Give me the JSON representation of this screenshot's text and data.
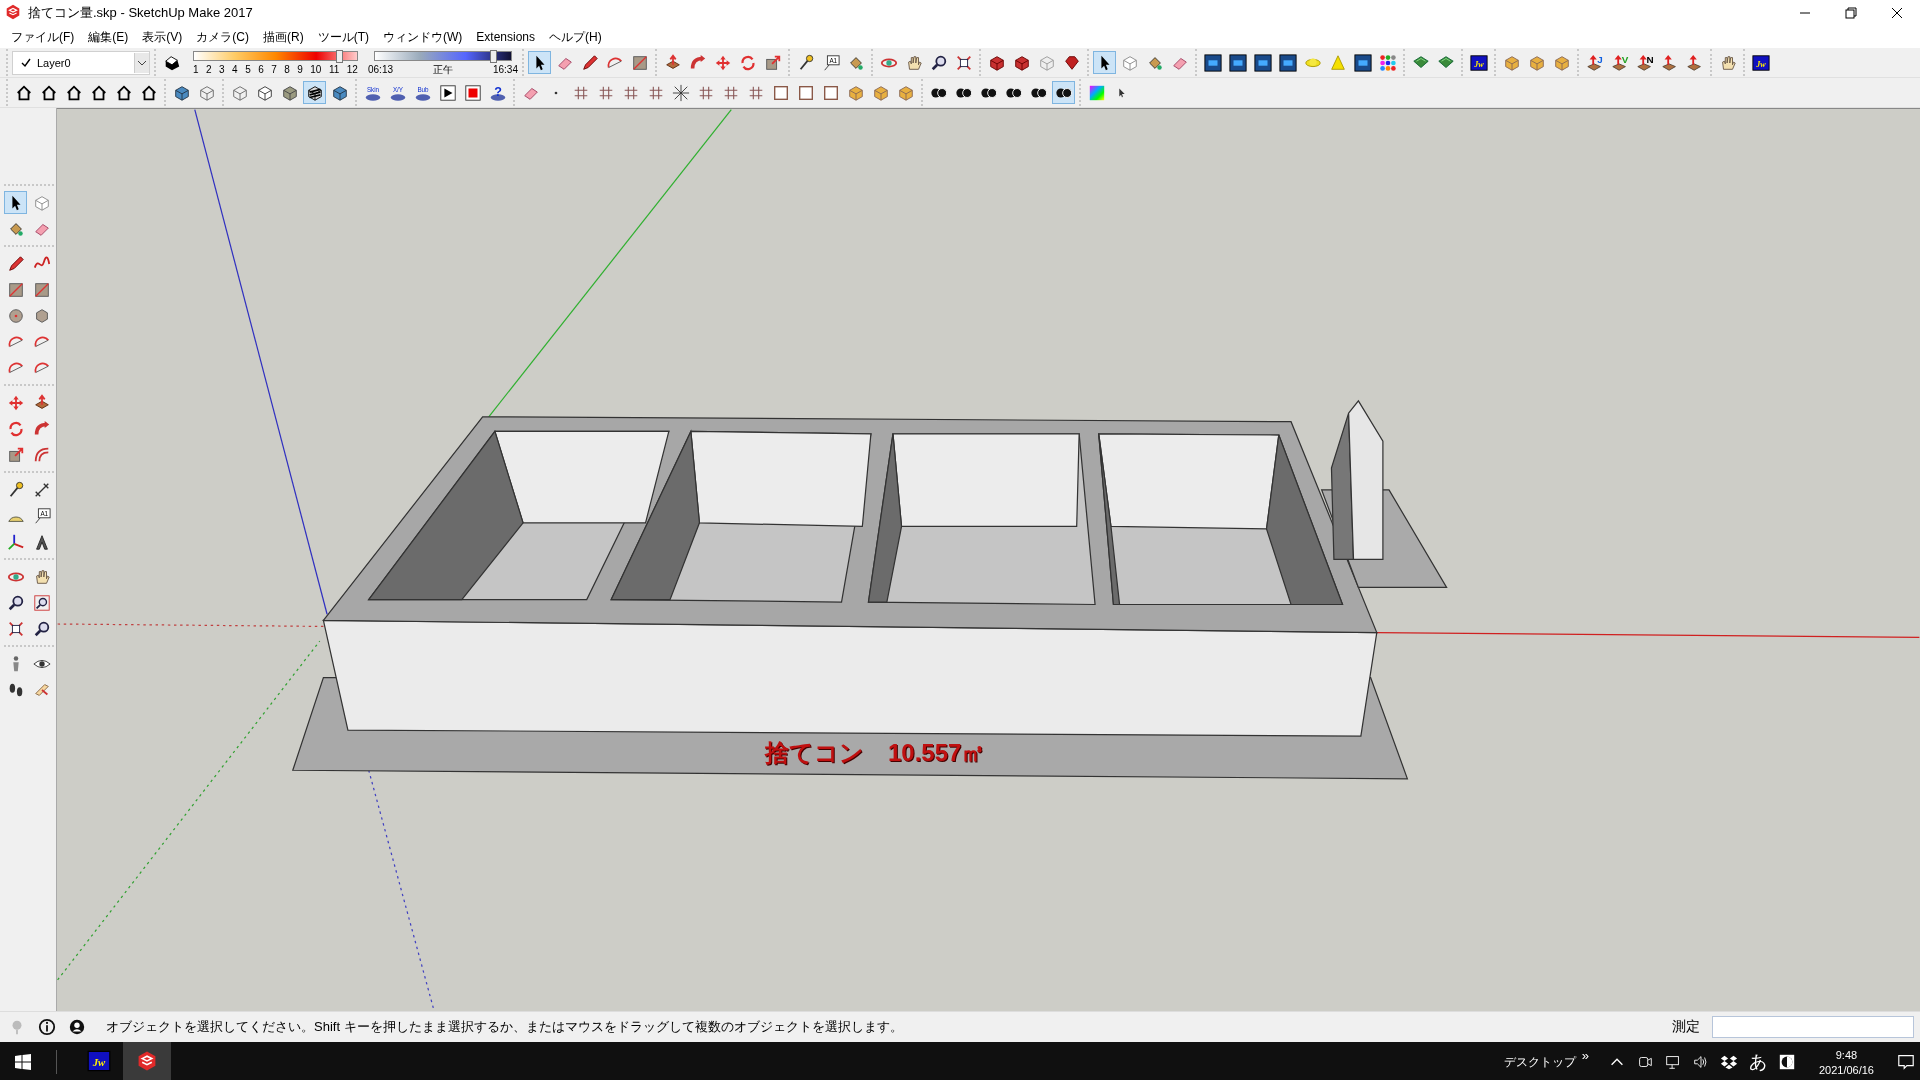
{
  "window": {
    "title": "捨てコン量.skp - SketchUp Make 2017"
  },
  "menu": [
    "ファイル(F)",
    "編集(E)",
    "表示(V)",
    "カメラ(C)",
    "描画(R)",
    "ツール(T)",
    "ウィンドウ(W)",
    "Extensions",
    "ヘルプ(H)"
  ],
  "layer": {
    "name": "Layer0",
    "current": true
  },
  "shadow_settings": {
    "month_labels": [
      "1",
      "2",
      "3",
      "4",
      "5",
      "6",
      "7",
      "8",
      "9",
      "10",
      "11",
      "12"
    ],
    "month": {
      "level": 0.89
    },
    "time": {
      "start": "06:13",
      "noon": "正午",
      "end": "16:34",
      "level": 0.87
    }
  },
  "toolbar_top": [
    [
      {
        "kind": "cursor",
        "selected": true
      },
      {
        "kind": "eraser",
        "selected": false
      },
      {
        "kind": "pencil",
        "selected": false
      },
      {
        "kind": "arc",
        "selected": false
      },
      {
        "kind": "rectangle",
        "selected": false
      }
    ],
    [
      {
        "kind": "pushpull",
        "selected": false
      },
      {
        "kind": "followme",
        "selected": false
      },
      {
        "kind": "move",
        "selected": false
      },
      {
        "kind": "rotate",
        "selected": false
      },
      {
        "kind": "scale",
        "selected": false
      }
    ],
    [
      {
        "kind": "tape",
        "selected": false
      },
      {
        "kind": "text",
        "label": "A1",
        "selected": false
      },
      {
        "kind": "paint",
        "selected": false
      }
    ],
    [
      {
        "kind": "orbit",
        "selected": false
      },
      {
        "kind": "pan",
        "selected": false
      },
      {
        "kind": "zoom",
        "selected": false
      },
      {
        "kind": "zoomext",
        "selected": false
      }
    ],
    [
      {
        "kind": "redbox",
        "selected": false
      },
      {
        "kind": "redbox",
        "selected": false
      },
      {
        "kind": "paper",
        "selected": false
      },
      {
        "kind": "gem",
        "selected": false
      }
    ],
    [
      {
        "kind": "cursor",
        "selected": true
      },
      {
        "kind": "component",
        "selected": false
      },
      {
        "kind": "paint",
        "selected": false
      },
      {
        "kind": "eraser",
        "selected": false
      }
    ],
    [
      {
        "kind": "bluepanel",
        "selected": false
      },
      {
        "kind": "bluepanel",
        "selected": false
      },
      {
        "kind": "bluepanel",
        "selected": false
      },
      {
        "kind": "bluepanel",
        "selected": false
      },
      {
        "kind": "globe",
        "selected": false
      },
      {
        "kind": "cone",
        "selected": false
      },
      {
        "kind": "bluepanel",
        "selected": false
      },
      {
        "kind": "dots",
        "selected": false
      }
    ],
    [
      {
        "kind": "green",
        "selected": false
      },
      {
        "kind": "green",
        "selected": false
      }
    ],
    [
      {
        "kind": "jw",
        "label": "Jw",
        "selected": false
      }
    ],
    [
      {
        "kind": "cubeyellow",
        "selected": false
      },
      {
        "kind": "cubeyellow",
        "selected": false
      },
      {
        "kind": "cubeyellow",
        "selected": false
      }
    ],
    [
      {
        "kind": "arrowup",
        "label": "J",
        "color": "#1060e0",
        "selected": false
      },
      {
        "kind": "arrowup",
        "label": "V",
        "color": "#20a020",
        "selected": false
      },
      {
        "kind": "arrowup",
        "label": "N",
        "color": "#000000",
        "selected": false
      },
      {
        "kind": "arrowup",
        "selected": false
      },
      {
        "kind": "arrowup",
        "selected": false
      }
    ],
    [
      {
        "kind": "pan",
        "selected": false
      }
    ],
    [
      {
        "kind": "jw",
        "label": "Jw",
        "selected": false
      }
    ]
  ],
  "toolbar_second": [
    [
      {
        "kind": "house",
        "selected": false
      },
      {
        "kind": "house",
        "selected": false
      },
      {
        "kind": "house",
        "selected": false
      },
      {
        "kind": "house",
        "selected": false
      },
      {
        "kind": "house",
        "selected": false
      },
      {
        "kind": "house",
        "selected": false
      }
    ],
    [
      {
        "kind": "cubeblue",
        "selected": false
      },
      {
        "kind": "cubewire",
        "selected": false
      }
    ],
    [
      {
        "kind": "cubewire",
        "selected": false
      },
      {
        "kind": "cubewhite",
        "selected": false
      },
      {
        "kind": "cubegrey",
        "selected": false
      },
      {
        "kind": "striped",
        "selected": true
      },
      {
        "kind": "cubeblue",
        "selected": false
      }
    ],
    [
      {
        "kind": "pad",
        "label": "Skin",
        "selected": false
      },
      {
        "kind": "pad",
        "label": "X/Y",
        "selected": false
      },
      {
        "kind": "pad",
        "label": "Bub",
        "selected": false
      },
      {
        "kind": "play",
        "selected": false
      },
      {
        "kind": "stop",
        "selected": false
      },
      {
        "kind": "help",
        "label": "?",
        "selected": false
      }
    ],
    [
      {
        "kind": "eraser",
        "selected": false
      },
      {
        "kind": "dot",
        "selected": false
      },
      {
        "kind": "grid",
        "selected": false
      },
      {
        "kind": "grid",
        "selected": false
      },
      {
        "kind": "grid",
        "selected": false
      },
      {
        "kind": "grid",
        "selected": false
      },
      {
        "kind": "star",
        "selected": false
      },
      {
        "kind": "grid",
        "selected": false
      },
      {
        "kind": "grid",
        "selected": false
      },
      {
        "kind": "grid",
        "selected": false
      },
      {
        "kind": "square",
        "selected": false
      },
      {
        "kind": "square",
        "selected": false
      },
      {
        "kind": "square",
        "selected": false
      },
      {
        "kind": "cubeyellow",
        "selected": false
      },
      {
        "kind": "cubeyellow",
        "selected": false
      },
      {
        "kind": "cubeyellow",
        "selected": false
      }
    ],
    [
      {
        "kind": "circles",
        "selected": false
      },
      {
        "kind": "circles",
        "selected": false
      },
      {
        "kind": "circles",
        "selected": false
      },
      {
        "kind": "circles",
        "selected": false
      },
      {
        "kind": "circles",
        "selected": false
      },
      {
        "kind": "circles",
        "selected": true
      }
    ],
    [
      {
        "kind": "gradient",
        "selected": false
      },
      {
        "kind": "smallcursor",
        "selected": false
      }
    ]
  ],
  "toolbar_left": [
    [
      {
        "kind": "cursor",
        "selected": true
      },
      {
        "kind": "component",
        "selected": false
      },
      {
        "kind": "paint",
        "selected": false
      },
      {
        "kind": "eraser",
        "selected": false
      }
    ],
    [
      {
        "kind": "pencil",
        "selected": false
      },
      {
        "kind": "freehand",
        "selected": false
      },
      {
        "kind": "rectangle",
        "selected": false
      },
      {
        "kind": "rectangle",
        "selected": false
      },
      {
        "kind": "circle",
        "selected": false
      },
      {
        "kind": "polygon",
        "selected": false
      },
      {
        "kind": "arc",
        "selected": false
      },
      {
        "kind": "arc",
        "selected": false
      },
      {
        "kind": "arc",
        "selected": false
      },
      {
        "kind": "arc",
        "selected": false
      }
    ],
    [
      {
        "kind": "move",
        "selected": false
      },
      {
        "kind": "pushpull",
        "selected": false
      },
      {
        "kind": "rotate",
        "selected": false
      },
      {
        "kind": "followme",
        "selected": false
      },
      {
        "kind": "scale",
        "selected": false
      },
      {
        "kind": "offset",
        "selected": false
      }
    ],
    [
      {
        "kind": "tape",
        "selected": false
      },
      {
        "kind": "dimension",
        "selected": false
      },
      {
        "kind": "protractor",
        "selected": false
      },
      {
        "kind": "text",
        "label": "A1",
        "selected": false
      },
      {
        "kind": "axes",
        "selected": false
      },
      {
        "kind": "text3d",
        "selected": false
      }
    ],
    [
      {
        "kind": "orbit",
        "selected": false
      },
      {
        "kind": "pan",
        "selected": false
      },
      {
        "kind": "zoom",
        "selected": false
      },
      {
        "kind": "zoomwin",
        "selected": false
      },
      {
        "kind": "zoomext",
        "selected": false
      },
      {
        "kind": "zoom",
        "selected": false
      }
    ],
    [
      {
        "kind": "position",
        "selected": false
      },
      {
        "kind": "look",
        "selected": false
      },
      {
        "kind": "walk",
        "selected": false
      },
      {
        "kind": "section",
        "selected": false
      }
    ]
  ],
  "model": {
    "label": "捨てコン　10.557㎥"
  },
  "status_bar": {
    "message": "オブジェクトを選択してください。Shift キーを押したまま選択するか、またはマウスをドラッグして複数のオブジェクトを選択します。",
    "measure_label": "測定"
  },
  "taskbar": {
    "apps": [
      {
        "kind": "jw",
        "label": "Jw",
        "selected": false
      },
      {
        "kind": "sketchup",
        "selected": true
      }
    ],
    "desktop": "デスクトップ",
    "chevron": "»",
    "ime": "あ",
    "time": "9:48",
    "date": "2021/06/16"
  }
}
